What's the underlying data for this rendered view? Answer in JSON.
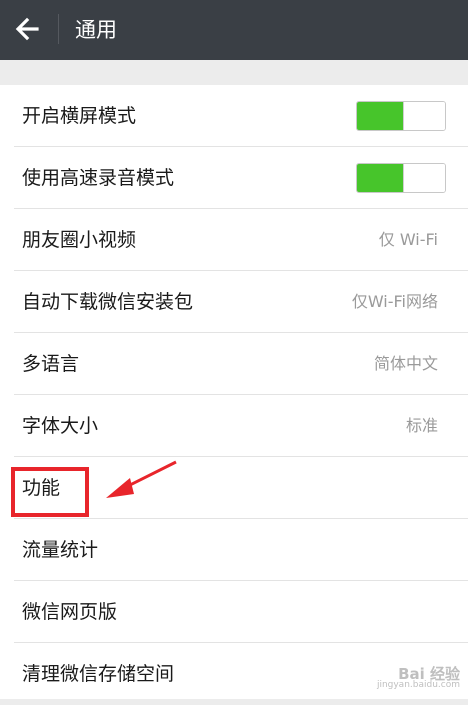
{
  "header": {
    "title": "通用",
    "back_icon": "arrow-left-icon",
    "background": "#3a3f45"
  },
  "settings": [
    {
      "label": "开启横屏模式",
      "control": "toggle",
      "on": true
    },
    {
      "label": "使用高速录音模式",
      "control": "toggle",
      "on": true
    },
    {
      "label": "朋友圈小视频",
      "value": "仅 Wi-Fi"
    },
    {
      "label": "自动下载微信安装包",
      "value": "仅Wi-Fi网络"
    },
    {
      "label": "多语言",
      "value": "简体中文"
    },
    {
      "label": "字体大小",
      "value": "标准"
    },
    {
      "label": "功能"
    },
    {
      "label": "流量统计"
    },
    {
      "label": "微信网页版"
    },
    {
      "label": "清理微信存储空间"
    }
  ],
  "annotation": {
    "highlighted_item": "功能",
    "color": "#e8252b"
  },
  "colors": {
    "toggle_on": "#47c52b",
    "text": "#1a1a1a",
    "value_text": "#9a9a9a"
  },
  "watermark": {
    "main": "Bai 经验",
    "sub": "jingyan.baidu.com"
  }
}
